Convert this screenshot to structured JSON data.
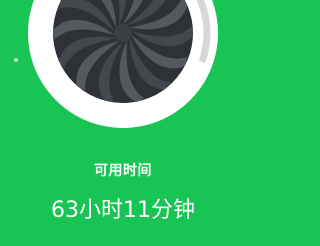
{
  "battery": {
    "available_time_label": "可用时间",
    "available_time_value": "63小时11分钟",
    "level_fraction": 0.25
  },
  "colors": {
    "background": "#17c454",
    "ring_fill": "#ffffff",
    "ring_track": "#d7d7d7",
    "fan_dark": "#2e3236",
    "fan_light": "#5b6066"
  },
  "icons": {
    "fan": "fan-turbine-icon"
  }
}
